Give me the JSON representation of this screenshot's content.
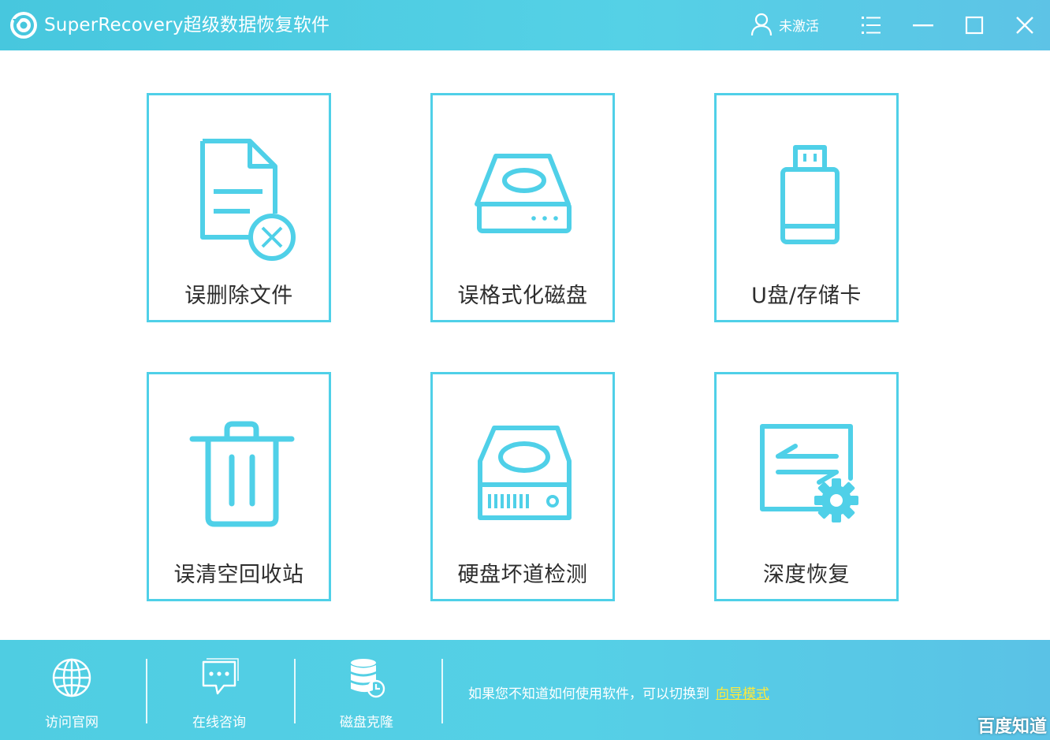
{
  "window": {
    "title": "SuperRecovery超级数据恢复软件",
    "user_status": "未激活",
    "icons": [
      "logo-icon",
      "user-icon",
      "menu-icon",
      "minimize-icon",
      "maximize-icon",
      "close-icon"
    ]
  },
  "cards": [
    {
      "label": "误删除文件",
      "icon": "deleted-file-icon"
    },
    {
      "label": "误格式化磁盘",
      "icon": "hard-disk-icon"
    },
    {
      "label": "U盘/存储卡",
      "icon": "usb-drive-icon"
    },
    {
      "label": "误清空回收站",
      "icon": "trash-bin-icon"
    },
    {
      "label": "硬盘坏道检测",
      "icon": "disk-check-icon"
    },
    {
      "label": "深度恢复",
      "icon": "deep-recovery-icon"
    }
  ],
  "footer": {
    "items": [
      {
        "label": "访问官网",
        "icon": "globe-icon"
      },
      {
        "label": "在线咨询",
        "icon": "chat-icon"
      },
      {
        "label": "磁盘克隆",
        "icon": "database-icon"
      }
    ],
    "hint_text": "如果您不知道如何使用软件，可以切换到",
    "hint_link": "向导模式"
  },
  "watermark": "百度知道",
  "colors": {
    "accent": "#4fd0e8",
    "titlebar": "#4ccbe0",
    "link": "#ffe93b",
    "label": "#2d2d2d"
  }
}
